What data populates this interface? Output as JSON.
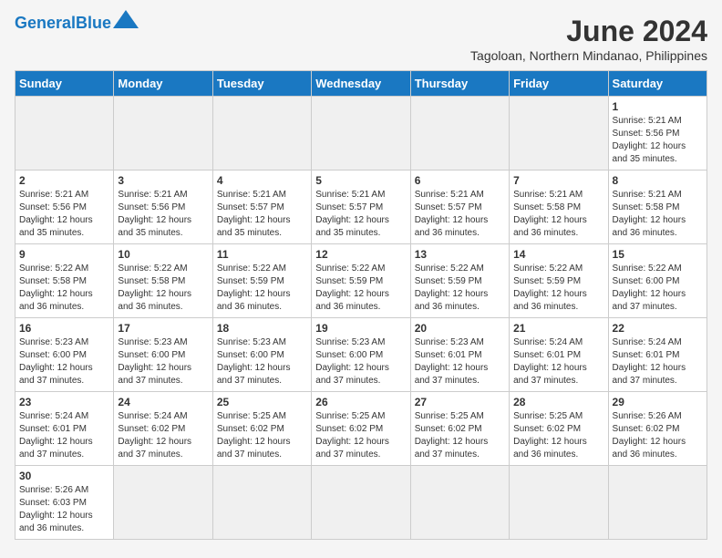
{
  "logo": {
    "text_general": "General",
    "text_blue": "Blue"
  },
  "title": "June 2024",
  "subtitle": "Tagoloan, Northern Mindanao, Philippines",
  "headers": [
    "Sunday",
    "Monday",
    "Tuesday",
    "Wednesday",
    "Thursday",
    "Friday",
    "Saturday"
  ],
  "weeks": [
    [
      {
        "day": "",
        "empty": true
      },
      {
        "day": "",
        "empty": true
      },
      {
        "day": "",
        "empty": true
      },
      {
        "day": "",
        "empty": true
      },
      {
        "day": "",
        "empty": true
      },
      {
        "day": "",
        "empty": true
      },
      {
        "day": "1",
        "sunrise": "5:21 AM",
        "sunset": "5:56 PM",
        "daylight": "12 hours and 35 minutes."
      }
    ],
    [
      {
        "day": "2",
        "sunrise": "5:21 AM",
        "sunset": "5:56 PM",
        "daylight": "12 hours and 35 minutes."
      },
      {
        "day": "3",
        "sunrise": "5:21 AM",
        "sunset": "5:56 PM",
        "daylight": "12 hours and 35 minutes."
      },
      {
        "day": "4",
        "sunrise": "5:21 AM",
        "sunset": "5:57 PM",
        "daylight": "12 hours and 35 minutes."
      },
      {
        "day": "5",
        "sunrise": "5:21 AM",
        "sunset": "5:57 PM",
        "daylight": "12 hours and 35 minutes."
      },
      {
        "day": "6",
        "sunrise": "5:21 AM",
        "sunset": "5:57 PM",
        "daylight": "12 hours and 36 minutes."
      },
      {
        "day": "7",
        "sunrise": "5:21 AM",
        "sunset": "5:58 PM",
        "daylight": "12 hours and 36 minutes."
      },
      {
        "day": "8",
        "sunrise": "5:21 AM",
        "sunset": "5:58 PM",
        "daylight": "12 hours and 36 minutes."
      }
    ],
    [
      {
        "day": "9",
        "sunrise": "5:22 AM",
        "sunset": "5:58 PM",
        "daylight": "12 hours and 36 minutes."
      },
      {
        "day": "10",
        "sunrise": "5:22 AM",
        "sunset": "5:58 PM",
        "daylight": "12 hours and 36 minutes."
      },
      {
        "day": "11",
        "sunrise": "5:22 AM",
        "sunset": "5:59 PM",
        "daylight": "12 hours and 36 minutes."
      },
      {
        "day": "12",
        "sunrise": "5:22 AM",
        "sunset": "5:59 PM",
        "daylight": "12 hours and 36 minutes."
      },
      {
        "day": "13",
        "sunrise": "5:22 AM",
        "sunset": "5:59 PM",
        "daylight": "12 hours and 36 minutes."
      },
      {
        "day": "14",
        "sunrise": "5:22 AM",
        "sunset": "5:59 PM",
        "daylight": "12 hours and 36 minutes."
      },
      {
        "day": "15",
        "sunrise": "5:22 AM",
        "sunset": "6:00 PM",
        "daylight": "12 hours and 37 minutes."
      }
    ],
    [
      {
        "day": "16",
        "sunrise": "5:23 AM",
        "sunset": "6:00 PM",
        "daylight": "12 hours and 37 minutes."
      },
      {
        "day": "17",
        "sunrise": "5:23 AM",
        "sunset": "6:00 PM",
        "daylight": "12 hours and 37 minutes."
      },
      {
        "day": "18",
        "sunrise": "5:23 AM",
        "sunset": "6:00 PM",
        "daylight": "12 hours and 37 minutes."
      },
      {
        "day": "19",
        "sunrise": "5:23 AM",
        "sunset": "6:00 PM",
        "daylight": "12 hours and 37 minutes."
      },
      {
        "day": "20",
        "sunrise": "5:23 AM",
        "sunset": "6:01 PM",
        "daylight": "12 hours and 37 minutes."
      },
      {
        "day": "21",
        "sunrise": "5:24 AM",
        "sunset": "6:01 PM",
        "daylight": "12 hours and 37 minutes."
      },
      {
        "day": "22",
        "sunrise": "5:24 AM",
        "sunset": "6:01 PM",
        "daylight": "12 hours and 37 minutes."
      }
    ],
    [
      {
        "day": "23",
        "sunrise": "5:24 AM",
        "sunset": "6:01 PM",
        "daylight": "12 hours and 37 minutes."
      },
      {
        "day": "24",
        "sunrise": "5:24 AM",
        "sunset": "6:02 PM",
        "daylight": "12 hours and 37 minutes."
      },
      {
        "day": "25",
        "sunrise": "5:25 AM",
        "sunset": "6:02 PM",
        "daylight": "12 hours and 37 minutes."
      },
      {
        "day": "26",
        "sunrise": "5:25 AM",
        "sunset": "6:02 PM",
        "daylight": "12 hours and 37 minutes."
      },
      {
        "day": "27",
        "sunrise": "5:25 AM",
        "sunset": "6:02 PM",
        "daylight": "12 hours and 37 minutes."
      },
      {
        "day": "28",
        "sunrise": "5:25 AM",
        "sunset": "6:02 PM",
        "daylight": "12 hours and 36 minutes."
      },
      {
        "day": "29",
        "sunrise": "5:26 AM",
        "sunset": "6:02 PM",
        "daylight": "12 hours and 36 minutes."
      }
    ],
    [
      {
        "day": "30",
        "sunrise": "5:26 AM",
        "sunset": "6:03 PM",
        "daylight": "12 hours and 36 minutes."
      },
      {
        "day": "",
        "empty": true
      },
      {
        "day": "",
        "empty": true
      },
      {
        "day": "",
        "empty": true
      },
      {
        "day": "",
        "empty": true
      },
      {
        "day": "",
        "empty": true
      },
      {
        "day": "",
        "empty": true
      }
    ]
  ],
  "labels": {
    "sunrise": "Sunrise:",
    "sunset": "Sunset:",
    "daylight": "Daylight:"
  },
  "colors": {
    "header_bg": "#1a78c2",
    "empty_bg": "#f0f0f0"
  }
}
